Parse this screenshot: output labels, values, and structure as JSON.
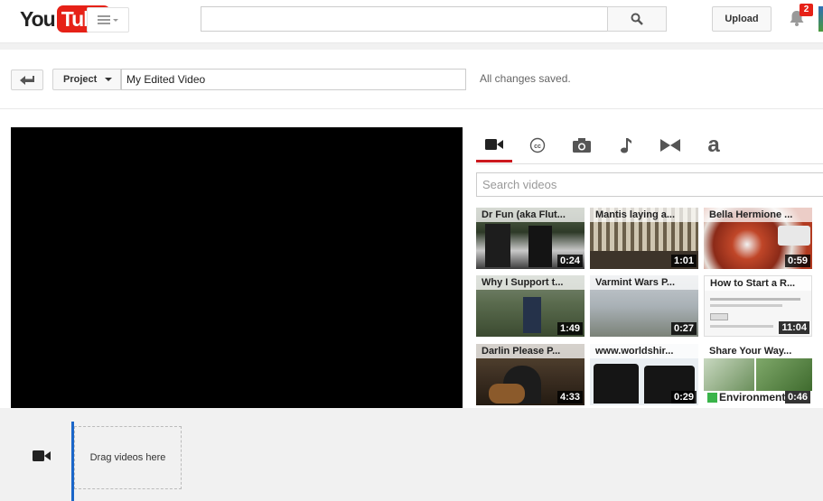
{
  "header": {
    "logo_you": "You",
    "logo_tube": "Tube",
    "upload_label": "Upload",
    "notification_count": "2"
  },
  "project_bar": {
    "project_label": "Project",
    "title_value": "My Edited Video",
    "save_status": "All changes saved."
  },
  "tabs": [
    {
      "icon": "video-camera-icon",
      "active": true
    },
    {
      "icon": "creative-commons-icon",
      "active": false
    },
    {
      "icon": "photo-camera-icon",
      "active": false
    },
    {
      "icon": "music-note-icon",
      "active": false
    },
    {
      "icon": "transitions-icon",
      "active": false
    },
    {
      "icon": "text-icon",
      "active": false,
      "glyph": "a"
    }
  ],
  "video_search": {
    "placeholder": "Search videos"
  },
  "videos": [
    {
      "title": "Dr Fun (aka Flut...",
      "duration": "0:24"
    },
    {
      "title": "Mantis laying a...",
      "duration": "1:01"
    },
    {
      "title": "Bella Hermione ...",
      "duration": "0:59"
    },
    {
      "title": "Why I Support t...",
      "duration": "1:49"
    },
    {
      "title": "Varmint Wars P...",
      "duration": "0:27"
    },
    {
      "title": "How to Start a R...",
      "duration": "11:04"
    },
    {
      "title": "Darlin Please P...",
      "duration": "4:33"
    },
    {
      "title": "www.worldshir...",
      "duration": "0:29"
    },
    {
      "title": "Share Your Way...",
      "duration": "0:46",
      "overlay_label": "Environment"
    }
  ],
  "timeline": {
    "drop_label": "Drag videos here"
  },
  "colors": {
    "accent_red": "#cc181e",
    "timeline_blue": "#1b66c9"
  }
}
